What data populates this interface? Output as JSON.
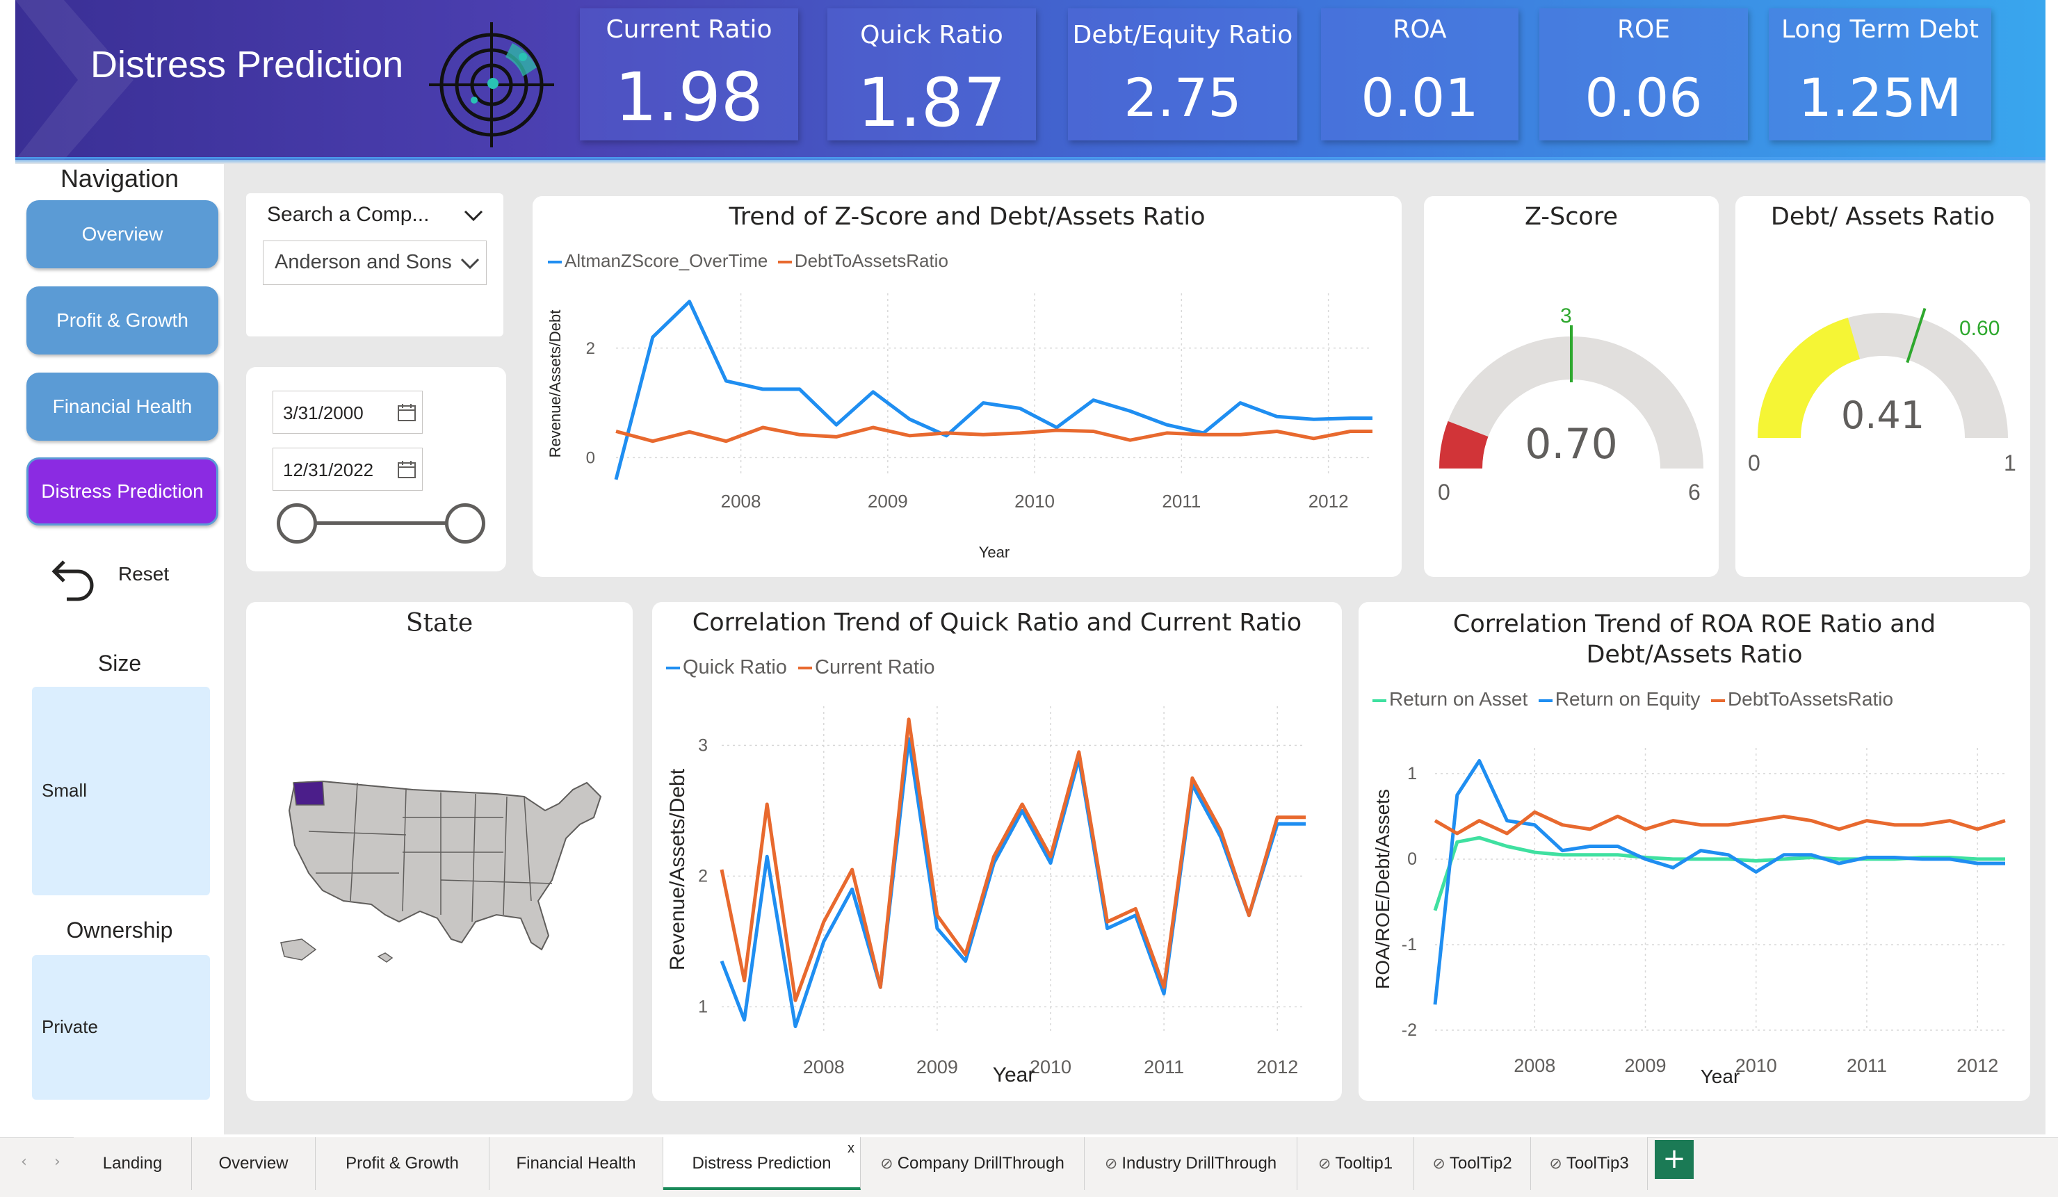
{
  "header": {
    "title": "Distress Prediction"
  },
  "kpis": [
    {
      "label": "Current Ratio",
      "value": "1.98"
    },
    {
      "label": "Quick Ratio",
      "value": "1.87"
    },
    {
      "label": "Debt/Equity Ratio",
      "value": "2.75"
    },
    {
      "label": "ROA",
      "value": "0.01"
    },
    {
      "label": "ROE",
      "value": "0.06"
    },
    {
      "label": "Long Term Debt",
      "value": "1.25M"
    }
  ],
  "nav": {
    "title": "Navigation",
    "items": [
      "Overview",
      "Profit & Growth",
      "Financial Health",
      "Distress Prediction"
    ],
    "active": "Distress Prediction",
    "reset_label": "Reset"
  },
  "slicers": {
    "size_title": "Size",
    "size_value": "Small",
    "ownership_title": "Ownership",
    "ownership_value": "Private"
  },
  "filter": {
    "search_placeholder": "Search a Comp...",
    "company": "Anderson and Sons",
    "date_from": "3/31/2000",
    "date_to": "12/31/2022"
  },
  "colors": {
    "accent_blue": "#1f8ef1",
    "accent_orange": "#e8692e",
    "accent_green": "#3fe0a0",
    "nav_blue": "#5b9bd5",
    "nav_active": "#8b2be2",
    "gauge_red": "#d13438",
    "gauge_yellow": "#f5f535",
    "gauge_target": "#2ea82e"
  },
  "trend_card": {
    "title": "Trend of Z-Score and Debt/Assets Ratio",
    "xlabel": "Year",
    "ylabel": "Revenue/Assets/Debt"
  },
  "zscore": {
    "title": "Z-Score",
    "value": "0.70",
    "min": "0",
    "max": "6",
    "target": "3"
  },
  "debt_assets": {
    "title": "Debt/ Assets Ratio",
    "value": "0.41",
    "min": "0",
    "max": "1",
    "target": "0.60"
  },
  "map": {
    "title": "State"
  },
  "corr1": {
    "title": "Correlation Trend of Quick Ratio and Current Ratio",
    "xlabel": "Year",
    "ylabel": "Revenue/Assets/Debt"
  },
  "corr2": {
    "title": "Correlation Trend of ROA ROE Ratio and Debt/Assets Ratio",
    "xlabel": "Year",
    "ylabel": "ROA/ROE/Debt/Assets"
  },
  "tabs": [
    "Landing",
    "Overview",
    "Profit & Growth",
    "Financial Health",
    "Distress Prediction",
    "Company DrillThrough",
    "Industry DrillThrough",
    "Tooltip1",
    "ToolTip2",
    "ToolTip3"
  ],
  "tabs_active": "Distress Prediction",
  "tab_close": "x",
  "tab_add": "+",
  "chart_data": [
    {
      "type": "line",
      "title": "Trend of Z-Score and Debt/Assets Ratio",
      "xlabel": "Year",
      "ylabel": "Revenue/Assets/Debt",
      "xlim": [
        2007.15,
        2012.3
      ],
      "ylim": [
        -0.3,
        3
      ],
      "xticks": [
        2008,
        2009,
        2010,
        2011,
        2012
      ],
      "yticks": [
        0,
        2
      ],
      "x": [
        2007.15,
        2007.4,
        2007.65,
        2007.9,
        2008.15,
        2008.4,
        2008.65,
        2008.9,
        2009.15,
        2009.4,
        2009.65,
        2009.9,
        2010.15,
        2010.4,
        2010.65,
        2010.9,
        2011.15,
        2011.4,
        2011.65,
        2011.9,
        2012.15,
        2012.3
      ],
      "series": [
        {
          "name": "AltmanZScore_OverTime",
          "color": "#1f8ef1",
          "values": [
            -0.4,
            2.2,
            2.85,
            1.4,
            1.25,
            1.25,
            0.6,
            1.2,
            0.7,
            0.4,
            1.0,
            0.9,
            0.55,
            1.05,
            0.85,
            0.6,
            0.45,
            1.0,
            0.75,
            0.7,
            0.72,
            0.72
          ]
        },
        {
          "name": "DebtToAssetsRatio",
          "color": "#e8692e",
          "values": [
            0.48,
            0.3,
            0.47,
            0.3,
            0.55,
            0.42,
            0.38,
            0.55,
            0.4,
            0.45,
            0.42,
            0.45,
            0.5,
            0.48,
            0.32,
            0.45,
            0.42,
            0.42,
            0.48,
            0.35,
            0.48,
            0.48
          ]
        }
      ]
    },
    {
      "type": "line",
      "title": "Correlation Trend of Quick Ratio and Current Ratio",
      "xlabel": "Year",
      "ylabel": "Revenue/Assets/Debt",
      "xlim": [
        2007.1,
        2012.25
      ],
      "ylim": [
        0.8,
        3.3
      ],
      "xticks": [
        2008,
        2009,
        2010,
        2011,
        2012
      ],
      "yticks": [
        1,
        2,
        3
      ],
      "x": [
        2007.1,
        2007.3,
        2007.5,
        2007.75,
        2008.0,
        2008.25,
        2008.5,
        2008.75,
        2009.0,
        2009.25,
        2009.5,
        2009.75,
        2010.0,
        2010.25,
        2010.5,
        2010.75,
        2011.0,
        2011.25,
        2011.5,
        2011.75,
        2012.0,
        2012.25
      ],
      "series": [
        {
          "name": "Quick Ratio",
          "color": "#1f8ef1",
          "values": [
            1.35,
            0.9,
            2.15,
            0.85,
            1.5,
            1.9,
            1.15,
            3.05,
            1.6,
            1.35,
            2.1,
            2.5,
            2.1,
            2.9,
            1.6,
            1.7,
            1.1,
            2.7,
            2.3,
            1.7,
            2.4,
            2.4
          ]
        },
        {
          "name": "Current Ratio",
          "color": "#e8692e",
          "values": [
            2.05,
            1.2,
            2.55,
            1.05,
            1.65,
            2.05,
            1.15,
            3.2,
            1.7,
            1.4,
            2.15,
            2.55,
            2.15,
            2.95,
            1.65,
            1.75,
            1.15,
            2.75,
            2.35,
            1.7,
            2.45,
            2.45
          ]
        }
      ]
    },
    {
      "type": "line",
      "title": "Correlation Trend of ROA ROE Ratio and Debt/Assets Ratio",
      "xlabel": "Year",
      "ylabel": "ROA/ROE/Debt/Assets",
      "xlim": [
        2007.1,
        2012.25
      ],
      "ylim": [
        -2,
        1.3
      ],
      "xticks": [
        2008,
        2009,
        2010,
        2011,
        2012
      ],
      "yticks": [
        -2,
        -1,
        0,
        1
      ],
      "x": [
        2007.1,
        2007.3,
        2007.5,
        2007.75,
        2008.0,
        2008.25,
        2008.5,
        2008.75,
        2009.0,
        2009.25,
        2009.5,
        2009.75,
        2010.0,
        2010.25,
        2010.5,
        2010.75,
        2011.0,
        2011.25,
        2011.5,
        2011.75,
        2012.0,
        2012.25
      ],
      "series": [
        {
          "name": "Return on Asset",
          "color": "#3fe0a0",
          "values": [
            -0.6,
            0.2,
            0.25,
            0.15,
            0.08,
            0.05,
            0.05,
            0.05,
            0.02,
            0.0,
            0.0,
            0.0,
            -0.02,
            0.0,
            0.02,
            0.0,
            0.0,
            0.0,
            0.02,
            0.02,
            0.0,
            0.0
          ]
        },
        {
          "name": "Return on Equity",
          "color": "#1f8ef1",
          "values": [
            -1.7,
            0.75,
            1.15,
            0.45,
            0.4,
            0.1,
            0.15,
            0.15,
            0.0,
            -0.1,
            0.1,
            0.05,
            -0.15,
            0.05,
            0.05,
            -0.05,
            0.02,
            0.02,
            0.0,
            0.0,
            -0.05,
            -0.05
          ]
        },
        {
          "name": "DebtToAssetsRatio",
          "color": "#e8692e",
          "values": [
            0.45,
            0.3,
            0.45,
            0.3,
            0.55,
            0.4,
            0.35,
            0.5,
            0.35,
            0.45,
            0.4,
            0.4,
            0.45,
            0.5,
            0.45,
            0.35,
            0.45,
            0.4,
            0.4,
            0.45,
            0.35,
            0.45
          ]
        }
      ]
    },
    {
      "type": "gauge",
      "title": "Z-Score",
      "value": 0.7,
      "min": 0,
      "max": 6,
      "target": 3
    },
    {
      "type": "gauge",
      "title": "Debt/ Assets Ratio",
      "value": 0.41,
      "min": 0,
      "max": 1,
      "target": 0.6
    }
  ]
}
